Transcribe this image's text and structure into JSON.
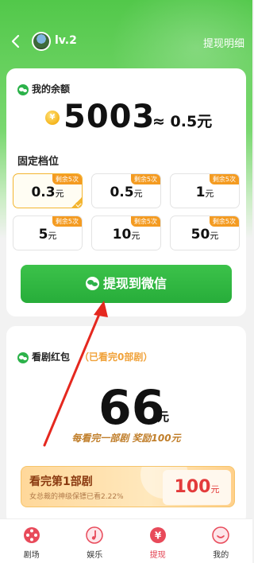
{
  "header": {
    "level": "lv.2",
    "detail_link": "提现明细"
  },
  "balance": {
    "title": "我的余额",
    "coin_symbol": "¥",
    "amount": "5003",
    "approx": "≈ 0.5元",
    "tier_label": "固定档位",
    "tiers": [
      {
        "tag": "剩余5次",
        "value": "0.3",
        "unit": "元",
        "selected": true
      },
      {
        "tag": "剩余5次",
        "value": "0.5",
        "unit": "元"
      },
      {
        "tag": "剩余5次",
        "value": "1",
        "unit": "元"
      },
      {
        "tag": "剩余5次",
        "value": "5",
        "unit": "元"
      },
      {
        "tag": "剩余5次",
        "value": "10",
        "unit": "元"
      },
      {
        "tag": "剩余5次",
        "value": "50",
        "unit": "元"
      }
    ],
    "withdraw_label": "提现到微信"
  },
  "drama": {
    "title": "看剧红包",
    "progress": "（已看完0部剧）",
    "big_value": "66",
    "big_unit": "元",
    "reward_note": "每看完一部剧 奖励100元",
    "task": {
      "name": "看完第1部剧",
      "sub": "女总裁的神级保镖已看2.22%",
      "reward_value": "100",
      "reward_unit": "元"
    }
  },
  "nav": [
    {
      "label": "剧场",
      "icon": "film-reel-icon"
    },
    {
      "label": "娱乐",
      "icon": "music-note-icon"
    },
    {
      "label": "提现",
      "icon": "yuan-icon",
      "active": true
    },
    {
      "label": "我的",
      "icon": "profile-icon"
    }
  ],
  "colors": {
    "brand_green": "#2cb24a",
    "accent_orange": "#f49b21",
    "active_red": "#e23a4a"
  }
}
